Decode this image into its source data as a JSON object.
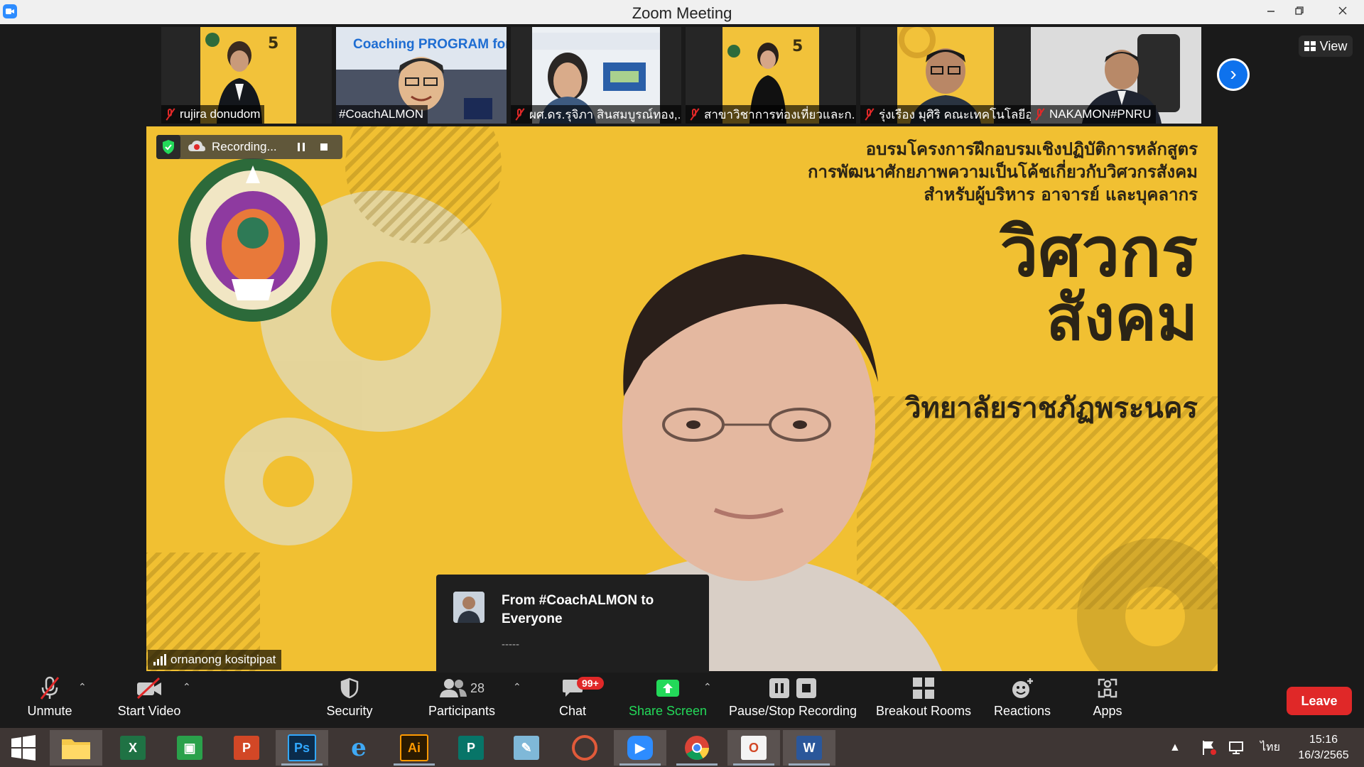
{
  "window": {
    "title": "Zoom Meeting"
  },
  "view_button": {
    "label": "View"
  },
  "thumbnails": [
    {
      "name": "rujira donudom",
      "muted": true
    },
    {
      "name": "#CoachALMON",
      "muted": false,
      "slide_text": "Coaching PROGRAM for"
    },
    {
      "name": "ผศ.ดร.รุจิภา สินสมบูรณ์ทอง,...",
      "muted": true
    },
    {
      "name": "สาขาวิชาการท่องเที่ยวและก...",
      "muted": true
    },
    {
      "name": "รุ่งเรือง มุศิริ คณะเทคโนโลยีอุ...",
      "muted": true
    },
    {
      "name": "NAKAMON#PNRU",
      "muted": true
    }
  ],
  "main_video": {
    "recording_label": "Recording...",
    "speaker_name": "ornanong kositpipat",
    "background_texts": {
      "line1": "อบรมโครงการฝึกอบรมเชิงปฏิบัติการหลักสูตร",
      "line2": "การพัฒนาศักยภาพความเป็นโค้ชเกี่ยวกับวิศวกรสังคม",
      "line3": "สำหรับผู้บริหาร อาจารย์ และบุคลากร",
      "big1": "วิศวกร",
      "big2": "สังคม",
      "university": "วิทยาลัยราชภัฏพระนคร"
    }
  },
  "chat_popup": {
    "from": "From #CoachALMON to Everyone",
    "message": "-----"
  },
  "toolbar": {
    "unmute": "Unmute",
    "start_video": "Start Video",
    "security": "Security",
    "participants": "Participants",
    "participants_count": "28",
    "chat": "Chat",
    "chat_badge": "99+",
    "share_screen": "Share Screen",
    "recording": "Pause/Stop Recording",
    "breakout_rooms": "Breakout Rooms",
    "reactions": "Reactions",
    "apps": "Apps",
    "leave": "Leave"
  },
  "taskbar": {
    "language": "ไทย",
    "time": "15:16",
    "date": "16/3/2565",
    "apps": [
      "start",
      "file-explorer",
      "excel",
      "store",
      "powerpoint",
      "photoshop",
      "internet-explorer",
      "illustrator",
      "publisher",
      "notepad",
      "photoscape",
      "zoom",
      "chrome",
      "office",
      "word"
    ]
  },
  "colors": {
    "accent_blue": "#0e72ed",
    "leave_red": "#e02828",
    "share_green": "#23d959",
    "slide_yellow": "#f1c032"
  }
}
